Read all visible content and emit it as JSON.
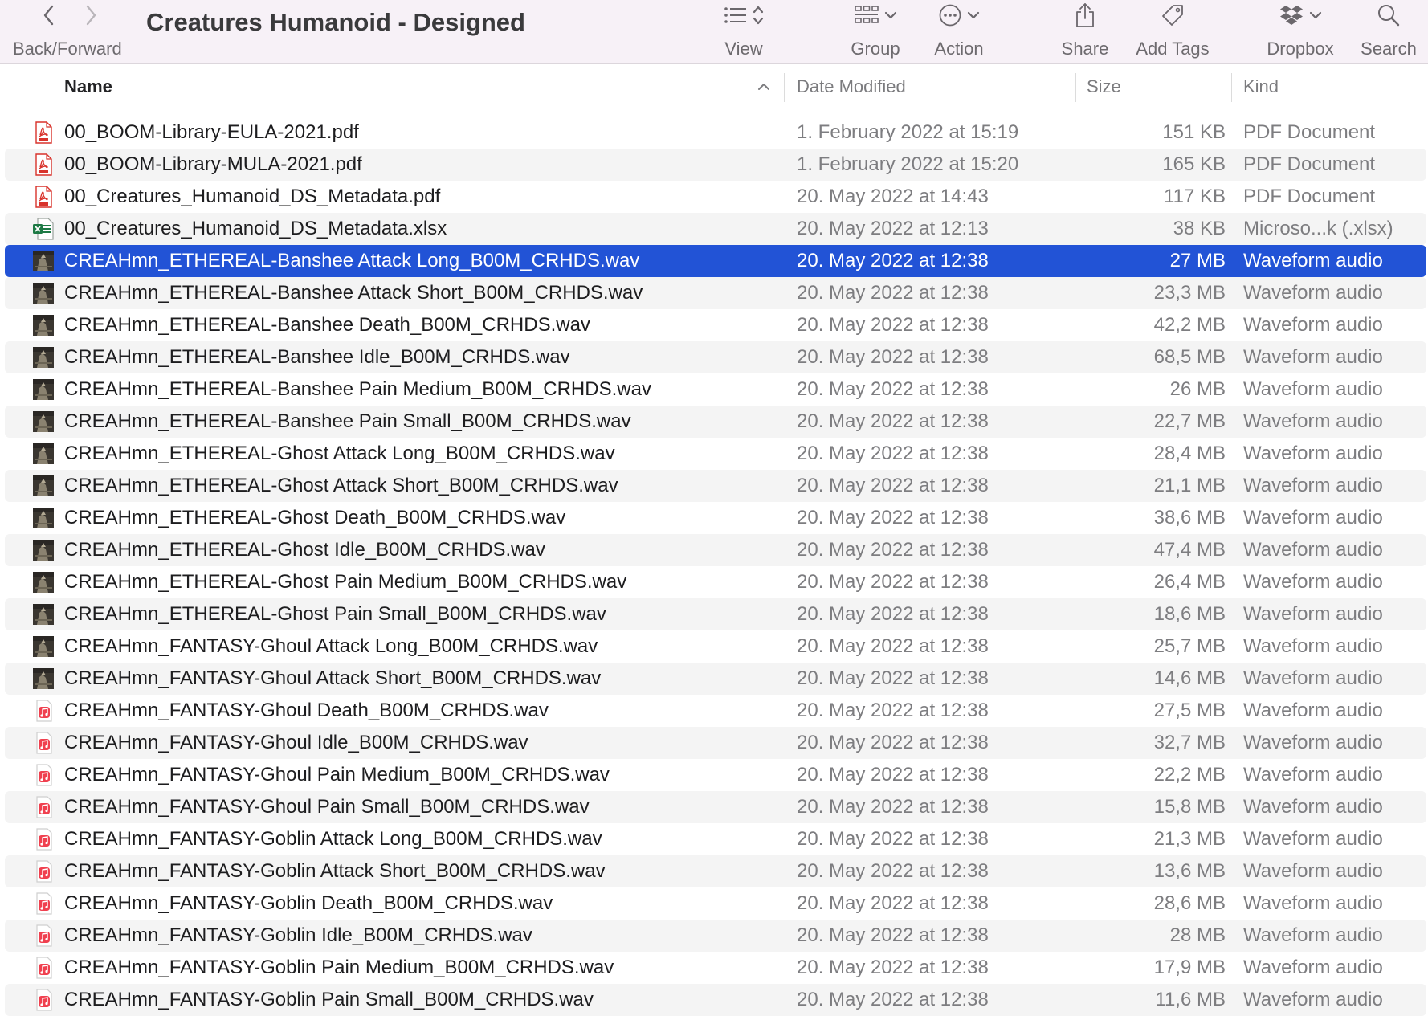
{
  "toolbar": {
    "back_forward_label": "Back/Forward",
    "title": "Creatures Humanoid - Designed",
    "tools": [
      {
        "id": "view",
        "label": "View",
        "icon": "list-view-icon"
      },
      {
        "id": "group",
        "label": "Group",
        "icon": "group-grid-icon"
      },
      {
        "id": "action",
        "label": "Action",
        "icon": "more-circle-icon"
      },
      {
        "id": "share",
        "label": "Share",
        "icon": "share-icon"
      },
      {
        "id": "tags",
        "label": "Add Tags",
        "icon": "tag-icon"
      },
      {
        "id": "dropbox",
        "label": "Dropbox",
        "icon": "dropbox-icon"
      },
      {
        "id": "search",
        "label": "Search",
        "icon": "search-icon"
      }
    ]
  },
  "columns": {
    "name": "Name",
    "date": "Date Modified",
    "size": "Size",
    "kind": "Kind"
  },
  "colors": {
    "selection": "#2253d6",
    "pdf_red": "#d8322b",
    "excel_green": "#1e7a45",
    "music_red": "#f0404f"
  },
  "files": [
    {
      "name": "00_BOOM-Library-EULA-2021.pdf",
      "date": "1. February 2022 at 15:19",
      "size": "151 KB",
      "kind": "PDF Document",
      "icon": "pdf-icon"
    },
    {
      "name": "00_BOOM-Library-MULA-2021.pdf",
      "date": "1. February 2022 at 15:20",
      "size": "165 KB",
      "kind": "PDF Document",
      "icon": "pdf-icon"
    },
    {
      "name": "00_Creatures_Humanoid_DS_Metadata.pdf",
      "date": "20. May 2022 at 14:43",
      "size": "117 KB",
      "kind": "PDF Document",
      "icon": "pdf-icon"
    },
    {
      "name": "00_Creatures_Humanoid_DS_Metadata.xlsx",
      "date": "20. May 2022 at 12:13",
      "size": "38 KB",
      "kind": "Microso...k (.xlsx)",
      "icon": "xlsx-icon"
    },
    {
      "name": "CREAHmn_ETHEREAL-Banshee Attack Long_B00M_CRHDS.wav",
      "date": "20. May 2022 at 12:38",
      "size": "27 MB",
      "kind": "Waveform audio",
      "icon": "wav-thumbnail-icon",
      "selected": true
    },
    {
      "name": "CREAHmn_ETHEREAL-Banshee Attack Short_B00M_CRHDS.wav",
      "date": "20. May 2022 at 12:38",
      "size": "23,3 MB",
      "kind": "Waveform audio",
      "icon": "wav-thumbnail-icon"
    },
    {
      "name": "CREAHmn_ETHEREAL-Banshee Death_B00M_CRHDS.wav",
      "date": "20. May 2022 at 12:38",
      "size": "42,2 MB",
      "kind": "Waveform audio",
      "icon": "wav-thumbnail-icon"
    },
    {
      "name": "CREAHmn_ETHEREAL-Banshee Idle_B00M_CRHDS.wav",
      "date": "20. May 2022 at 12:38",
      "size": "68,5 MB",
      "kind": "Waveform audio",
      "icon": "wav-thumbnail-icon"
    },
    {
      "name": "CREAHmn_ETHEREAL-Banshee Pain Medium_B00M_CRHDS.wav",
      "date": "20. May 2022 at 12:38",
      "size": "26 MB",
      "kind": "Waveform audio",
      "icon": "wav-thumbnail-icon"
    },
    {
      "name": "CREAHmn_ETHEREAL-Banshee Pain Small_B00M_CRHDS.wav",
      "date": "20. May 2022 at 12:38",
      "size": "22,7 MB",
      "kind": "Waveform audio",
      "icon": "wav-thumbnail-icon"
    },
    {
      "name": "CREAHmn_ETHEREAL-Ghost Attack Long_B00M_CRHDS.wav",
      "date": "20. May 2022 at 12:38",
      "size": "28,4 MB",
      "kind": "Waveform audio",
      "icon": "wav-thumbnail-icon"
    },
    {
      "name": "CREAHmn_ETHEREAL-Ghost Attack Short_B00M_CRHDS.wav",
      "date": "20. May 2022 at 12:38",
      "size": "21,1 MB",
      "kind": "Waveform audio",
      "icon": "wav-thumbnail-icon"
    },
    {
      "name": "CREAHmn_ETHEREAL-Ghost Death_B00M_CRHDS.wav",
      "date": "20. May 2022 at 12:38",
      "size": "38,6 MB",
      "kind": "Waveform audio",
      "icon": "wav-thumbnail-icon"
    },
    {
      "name": "CREAHmn_ETHEREAL-Ghost Idle_B00M_CRHDS.wav",
      "date": "20. May 2022 at 12:38",
      "size": "47,4 MB",
      "kind": "Waveform audio",
      "icon": "wav-thumbnail-icon"
    },
    {
      "name": "CREAHmn_ETHEREAL-Ghost Pain Medium_B00M_CRHDS.wav",
      "date": "20. May 2022 at 12:38",
      "size": "26,4 MB",
      "kind": "Waveform audio",
      "icon": "wav-thumbnail-icon"
    },
    {
      "name": "CREAHmn_ETHEREAL-Ghost Pain Small_B00M_CRHDS.wav",
      "date": "20. May 2022 at 12:38",
      "size": "18,6 MB",
      "kind": "Waveform audio",
      "icon": "wav-thumbnail-icon"
    },
    {
      "name": "CREAHmn_FANTASY-Ghoul Attack Long_B00M_CRHDS.wav",
      "date": "20. May 2022 at 12:38",
      "size": "25,7 MB",
      "kind": "Waveform audio",
      "icon": "wav-thumbnail-icon"
    },
    {
      "name": "CREAHmn_FANTASY-Ghoul Attack Short_B00M_CRHDS.wav",
      "date": "20. May 2022 at 12:38",
      "size": "14,6 MB",
      "kind": "Waveform audio",
      "icon": "wav-thumbnail-icon"
    },
    {
      "name": "CREAHmn_FANTASY-Ghoul Death_B00M_CRHDS.wav",
      "date": "20. May 2022 at 12:38",
      "size": "27,5 MB",
      "kind": "Waveform audio",
      "icon": "music-file-icon"
    },
    {
      "name": "CREAHmn_FANTASY-Ghoul Idle_B00M_CRHDS.wav",
      "date": "20. May 2022 at 12:38",
      "size": "32,7 MB",
      "kind": "Waveform audio",
      "icon": "music-file-icon"
    },
    {
      "name": "CREAHmn_FANTASY-Ghoul Pain Medium_B00M_CRHDS.wav",
      "date": "20. May 2022 at 12:38",
      "size": "22,2 MB",
      "kind": "Waveform audio",
      "icon": "music-file-icon"
    },
    {
      "name": "CREAHmn_FANTASY-Ghoul Pain Small_B00M_CRHDS.wav",
      "date": "20. May 2022 at 12:38",
      "size": "15,8 MB",
      "kind": "Waveform audio",
      "icon": "music-file-icon"
    },
    {
      "name": "CREAHmn_FANTASY-Goblin Attack Long_B00M_CRHDS.wav",
      "date": "20. May 2022 at 12:38",
      "size": "21,3 MB",
      "kind": "Waveform audio",
      "icon": "music-file-icon"
    },
    {
      "name": "CREAHmn_FANTASY-Goblin Attack Short_B00M_CRHDS.wav",
      "date": "20. May 2022 at 12:38",
      "size": "13,6 MB",
      "kind": "Waveform audio",
      "icon": "music-file-icon"
    },
    {
      "name": "CREAHmn_FANTASY-Goblin Death_B00M_CRHDS.wav",
      "date": "20. May 2022 at 12:38",
      "size": "28,6 MB",
      "kind": "Waveform audio",
      "icon": "music-file-icon"
    },
    {
      "name": "CREAHmn_FANTASY-Goblin Idle_B00M_CRHDS.wav",
      "date": "20. May 2022 at 12:38",
      "size": "28 MB",
      "kind": "Waveform audio",
      "icon": "music-file-icon"
    },
    {
      "name": "CREAHmn_FANTASY-Goblin Pain Medium_B00M_CRHDS.wav",
      "date": "20. May 2022 at 12:38",
      "size": "17,9 MB",
      "kind": "Waveform audio",
      "icon": "music-file-icon"
    },
    {
      "name": "CREAHmn_FANTASY-Goblin Pain Small_B00M_CRHDS.wav",
      "date": "20. May 2022 at 12:38",
      "size": "11,6 MB",
      "kind": "Waveform audio",
      "icon": "music-file-icon"
    }
  ]
}
